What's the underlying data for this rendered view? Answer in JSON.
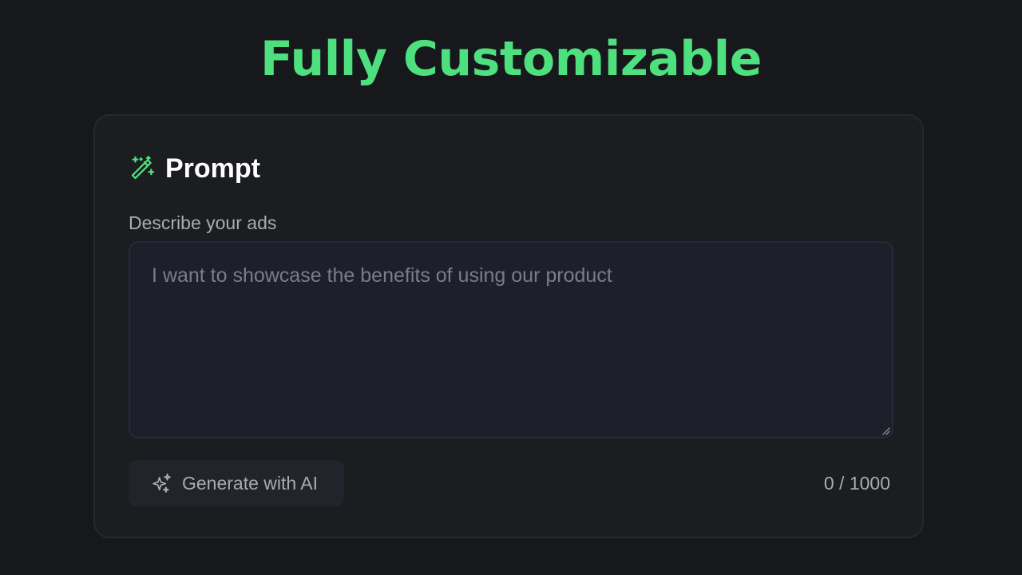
{
  "hero": {
    "title": "Fully Customizable"
  },
  "card": {
    "icon": "magic-wand-icon",
    "title": "Prompt",
    "field_label": "Describe your ads",
    "textarea": {
      "value": "",
      "placeholder": "I want to showcase the benefits of using our product"
    },
    "generate_button": {
      "icon": "sparkles-icon",
      "label": "Generate with AI"
    },
    "char_count": "0 / 1000"
  },
  "colors": {
    "background": "#17181c",
    "accent": "#4ee07e",
    "card": "#1b1d20",
    "input": "#1e1f2a",
    "muted_text": "#a8abb2"
  }
}
